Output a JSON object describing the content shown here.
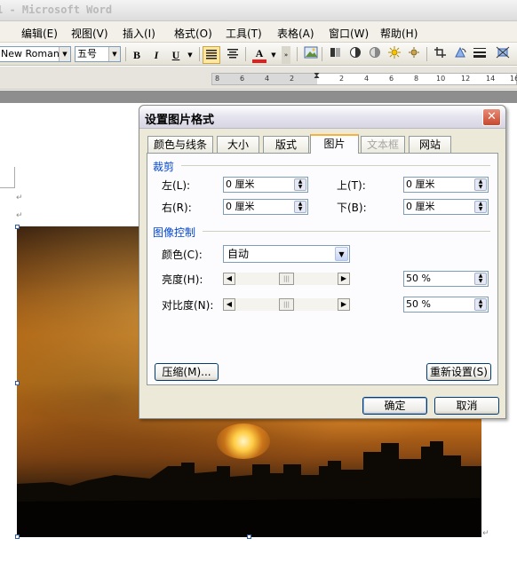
{
  "window": {
    "title": "1 - Microsoft Word"
  },
  "menubar": [
    "编辑(E)",
    "视图(V)",
    "插入(I)",
    "格式(O)",
    "工具(T)",
    "表格(A)",
    "窗口(W)",
    "帮助(H)"
  ],
  "toolbar": {
    "font_name": "New Roman",
    "font_size": "五号",
    "bold": "B",
    "italic": "I",
    "underline": "U",
    "font_color_letter": "A",
    "font_color_value": "#e0201c"
  },
  "ruler": {
    "ticks": [
      "8",
      "6",
      "4",
      "2",
      "2",
      "4",
      "6",
      "8",
      "10",
      "12",
      "14",
      "16"
    ]
  },
  "dialog": {
    "title": "设置图片格式",
    "close": "✕",
    "tabs": [
      {
        "label": "颜色与线条"
      },
      {
        "label": "大小"
      },
      {
        "label": "版式"
      },
      {
        "label": "图片"
      },
      {
        "label": "文本框"
      },
      {
        "label": "网站"
      }
    ],
    "crop": {
      "heading": "裁剪",
      "left_label": "左(L):",
      "left_value": "0 厘米",
      "top_label": "上(T):",
      "top_value": "0 厘米",
      "right_label": "右(R):",
      "right_value": "0 厘米",
      "bottom_label": "下(B):",
      "bottom_value": "0 厘米"
    },
    "image_control": {
      "heading": "图像控制",
      "color_label": "颜色(C):",
      "color_value": "自动",
      "brightness_label": "亮度(H):",
      "brightness_value": "50 %",
      "brightness_level": 0.5,
      "contrast_label": "对比度(N):",
      "contrast_value": "50 %",
      "contrast_level": 0.5
    },
    "compress_button": "压缩(M)...",
    "reset_button": "重新设置(S)",
    "ok_button": "确定",
    "cancel_button": "取消"
  }
}
